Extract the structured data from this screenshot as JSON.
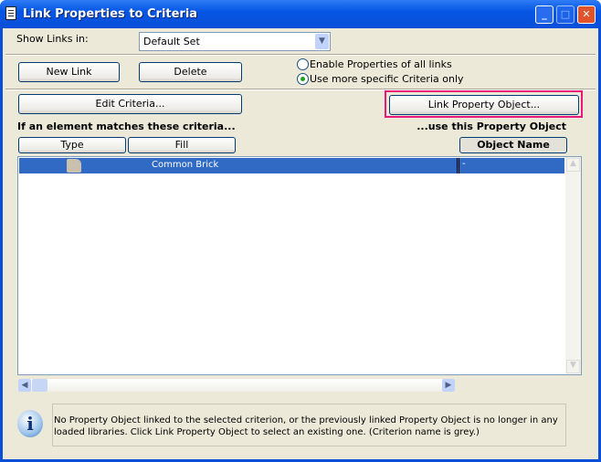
{
  "window": {
    "title": "Link Properties to Criteria"
  },
  "show_links": {
    "label": "Show Links in:",
    "value": "Default Set"
  },
  "buttons": {
    "new_link": "New Link",
    "delete": "Delete",
    "edit_criteria": "Edit Criteria...",
    "link_property_object": "Link Property Object..."
  },
  "radios": [
    {
      "label": "Enable Properties of all links",
      "checked": false
    },
    {
      "label": "Use more specific Criteria only",
      "checked": true
    }
  ],
  "labels": {
    "left": "If an element matches these criteria...",
    "right": "...use this Property Object"
  },
  "columns": {
    "type": "Type",
    "fill": "Fill",
    "object_name": "Object Name"
  },
  "rows": [
    {
      "fill": "Common Brick",
      "object_name": "-",
      "selected": true
    }
  ],
  "info": {
    "text": "No Property Object linked to the selected criterion, or the previously linked Property Object is no longer in any loaded libraries. Click Link Property Object to select an existing one. (Criterion name is grey.)"
  },
  "colors": {
    "selection": "#316ac5",
    "highlight": "#e8197a"
  }
}
